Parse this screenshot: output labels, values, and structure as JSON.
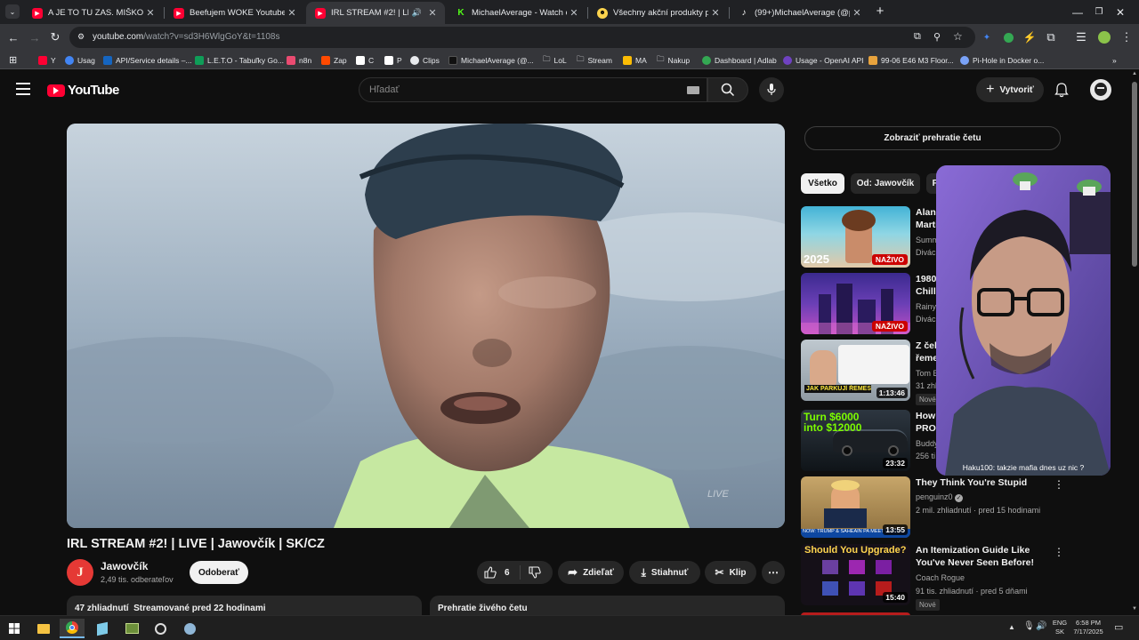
{
  "browser": {
    "tabs": [
      {
        "title": "A JE TO TU ZAS. MIŠKO SI NEDÁ",
        "icon": "youtube-icon",
        "active": false
      },
      {
        "title": "Beefujem WOKE Youtuberov. N",
        "icon": "youtube-icon",
        "active": false
      },
      {
        "title": "IRL STREAM #2! | LIVE | Jaw",
        "icon": "youtube-icon",
        "active": true
      },
      {
        "title": "MichaelAverage - Watch clips o",
        "icon": "kick-icon",
        "active": false
      },
      {
        "title": "Všechny akční produkty pro ko",
        "icon": "smiley-icon",
        "active": false
      },
      {
        "title": "(99+)MichaelAverage (@proste",
        "icon": "tiktok-icon",
        "active": false
      }
    ],
    "url_host": "youtube.com",
    "url_path": "/watch?v=sd3H6WlgGoY&t=1108s",
    "bookmarks": [
      "Y",
      "Usag",
      "API/Service details –...",
      "L.E.T.O - Tabuľky Go...",
      "n8n",
      "Zap",
      "C",
      "P",
      "Clips",
      "MichaelAverage (@...",
      "LoL",
      "Stream",
      "MA",
      "Nakup",
      "Dashboard | Adlab",
      "Usage - OpenAI API",
      "99-06 E46 M3 Floor...",
      "Pi-Hole in Docker o..."
    ]
  },
  "youtube": {
    "logo_text": "YouTube",
    "search_placeholder": "Hľadať",
    "create_label": "Vytvoriť",
    "show_chat_replay": "Zobraziť prehratie četu",
    "video": {
      "watermark": "LIVE",
      "title": "IRL STREAM #2! | LIVE | Jawovčík | SK/CZ",
      "channel": "Jawovčík",
      "subscribers": "2,49 tis. odberateľov",
      "subscribe_label": "Odoberať",
      "likes": "6",
      "share_label": "Zdieľať",
      "download_label": "Stiahnuť",
      "clip_label": "Klip",
      "views_line": "47 zhliadnutí  Streamované pred 22 hodinami",
      "chat_replay_label": "Prehratie živého četu"
    },
    "chips": [
      "Všetko",
      "Od: Jawovčík",
      "P"
    ],
    "recommendations": [
      {
        "title_lines": [
          "Alan",
          "Marti"
        ],
        "channel": "Summ",
        "meta": "Divác",
        "live": "NAŽIVO",
        "duration": "",
        "badge": "",
        "thumb_text": "2025"
      },
      {
        "title_lines": [
          "1980",
          "Chilli"
        ],
        "channel": "Rainy",
        "meta": "Divác",
        "live": "NAŽIVO",
        "duration": "",
        "badge": "",
        "thumb_text": ""
      },
      {
        "title_lines": [
          "Z čeh",
          "řeme"
        ],
        "channel": "Tom E",
        "meta": "31 zhl",
        "live": "",
        "duration": "1:13:46",
        "badge": "Nové",
        "thumb_text": "JAK PARKUJÍ ŘEMESLNÍCI"
      },
      {
        "title_lines": [
          "How",
          "PROC"
        ],
        "channel": "Buddy",
        "meta": "256 ti",
        "live": "",
        "duration": "23:32",
        "badge": "",
        "thumb_text": "Turn $6000 into $12000"
      },
      {
        "title_lines": [
          "They Think You're Stupid"
        ],
        "channel": "penguinz0",
        "meta": "2 mil. zhliadnutí · pred 15 hodinami",
        "live": "",
        "duration": "13:55",
        "badge": "",
        "thumb_text": "NOW: TRUMP & SAHEAIN PA MEET IN"
      },
      {
        "title_lines": [
          "An Itemization Guide Like",
          "You've Never Seen Before!"
        ],
        "channel": "Coach Rogue",
        "meta": "91 tis. zhliadnutí · pred 5 dňami",
        "live": "",
        "duration": "15:40",
        "badge": "Nové",
        "thumb_text": "Should You Upgrade?"
      }
    ]
  },
  "stream_overlay": {
    "chat_line": "Haku100: takzie mafia dnes uz nic ?"
  },
  "taskbar": {
    "lang": "ENG",
    "layout": "SK",
    "time": "6:58 PM",
    "date": "7/17/2025"
  },
  "colors": {
    "youtube_red": "#ff0033",
    "bg": "#0f0f0f",
    "live_red": "#cc0000"
  }
}
